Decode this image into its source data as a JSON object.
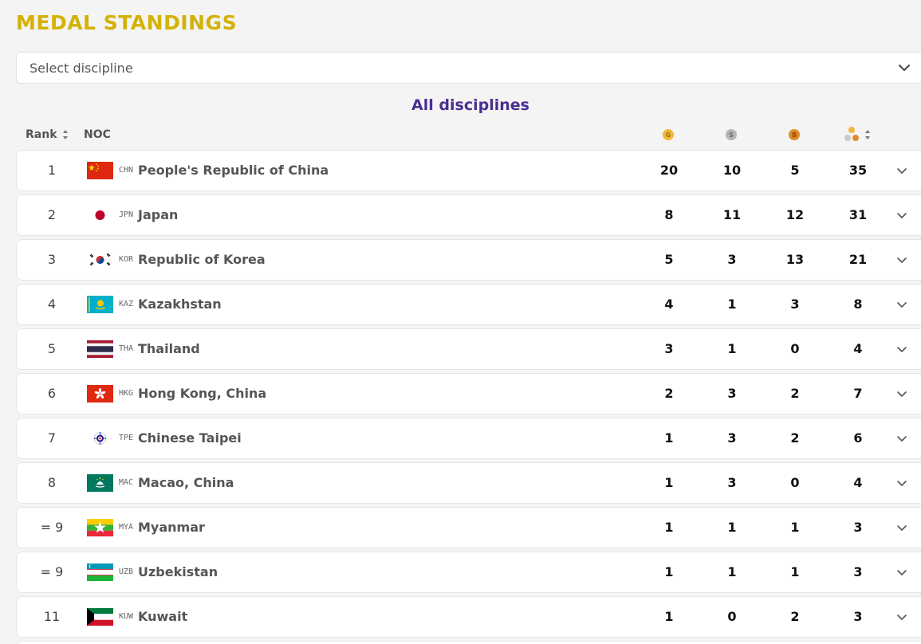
{
  "title": "MEDAL STANDINGS",
  "select": {
    "placeholder": "Select discipline"
  },
  "subtitle": "All disciplines",
  "headers": {
    "rank": "Rank",
    "noc": "NOC",
    "gold_letter": "G",
    "silver_letter": "S",
    "bronze_letter": "B"
  },
  "colors": {
    "title": "#d4b106",
    "subtitle": "#4a2f8f",
    "gold": "#f0b73a",
    "silver": "#b5b5b5",
    "bronze": "#e0892a"
  },
  "icons": {
    "select_chevron": "chevron-down-icon",
    "rank_sort": "sort-icon",
    "total_sort": "sort-icon",
    "row_expand": "chevron-down-icon"
  },
  "rows": [
    {
      "rank": "1",
      "code": "CHN",
      "name": "People's Republic of China",
      "gold": "20",
      "silver": "10",
      "bronze": "5",
      "total": "35",
      "flag": "chn"
    },
    {
      "rank": "2",
      "code": "JPN",
      "name": "Japan",
      "gold": "8",
      "silver": "11",
      "bronze": "12",
      "total": "31",
      "flag": "jpn"
    },
    {
      "rank": "3",
      "code": "KOR",
      "name": "Republic of Korea",
      "gold": "5",
      "silver": "3",
      "bronze": "13",
      "total": "21",
      "flag": "kor"
    },
    {
      "rank": "4",
      "code": "KAZ",
      "name": "Kazakhstan",
      "gold": "4",
      "silver": "1",
      "bronze": "3",
      "total": "8",
      "flag": "kaz"
    },
    {
      "rank": "5",
      "code": "THA",
      "name": "Thailand",
      "gold": "3",
      "silver": "1",
      "bronze": "0",
      "total": "4",
      "flag": "tha"
    },
    {
      "rank": "6",
      "code": "HKG",
      "name": "Hong Kong, China",
      "gold": "2",
      "silver": "3",
      "bronze": "2",
      "total": "7",
      "flag": "hkg"
    },
    {
      "rank": "7",
      "code": "TPE",
      "name": "Chinese Taipei",
      "gold": "1",
      "silver": "3",
      "bronze": "2",
      "total": "6",
      "flag": "tpe"
    },
    {
      "rank": "8",
      "code": "MAC",
      "name": "Macao, China",
      "gold": "1",
      "silver": "3",
      "bronze": "0",
      "total": "4",
      "flag": "mac"
    },
    {
      "rank": "= 9",
      "code": "MYA",
      "name": "Myanmar",
      "gold": "1",
      "silver": "1",
      "bronze": "1",
      "total": "3",
      "flag": "mya"
    },
    {
      "rank": "= 9",
      "code": "UZB",
      "name": "Uzbekistan",
      "gold": "1",
      "silver": "1",
      "bronze": "1",
      "total": "3",
      "flag": "uzb"
    },
    {
      "rank": "11",
      "code": "KUW",
      "name": "Kuwait",
      "gold": "1",
      "silver": "0",
      "bronze": "2",
      "total": "3",
      "flag": "kuw"
    }
  ]
}
